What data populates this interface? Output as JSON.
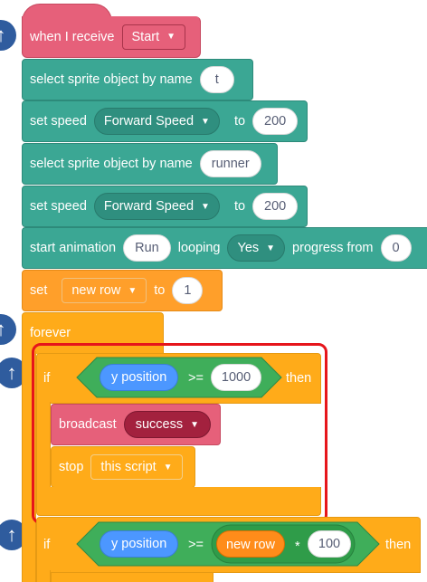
{
  "blocks": {
    "when_receive": {
      "label": "when I receive",
      "message": "Start"
    },
    "select1": {
      "label": "select sprite object by name",
      "value": "t"
    },
    "speed1": {
      "label": "set speed",
      "dropdown": "Forward Speed",
      "to": "to",
      "value": "200"
    },
    "select2": {
      "label": "select sprite object by name",
      "value": "runner"
    },
    "speed2": {
      "label": "set speed",
      "dropdown": "Forward Speed",
      "to": "to",
      "value": "200"
    },
    "anim": {
      "label": "start animation",
      "name": "Run",
      "looping": "looping",
      "loop_value": "Yes",
      "progress": "progress from",
      "progress_value": "0"
    },
    "setvar": {
      "label": "set",
      "var": "new row",
      "to": "to",
      "value": "1"
    },
    "forever": {
      "label": "forever"
    },
    "if1": {
      "if": "if",
      "reporter": "y position",
      "op": ">=",
      "value": "1000",
      "then": "then"
    },
    "broadcast": {
      "label": "broadcast",
      "message": "success"
    },
    "stop": {
      "label": "stop",
      "option": "this script"
    },
    "if2": {
      "if": "if",
      "reporter": "y position",
      "op": ">=",
      "var": "new row",
      "mult": "*",
      "value": "100",
      "then": "then"
    }
  },
  "colors": {
    "event": "#e6607a",
    "sensing_ext": "#3ba794",
    "variables": "#ff9f2a",
    "control": "#ffab19",
    "highlight": "#e6151b"
  },
  "icons": [
    "arrow-up-icon",
    "chevron-down-icon"
  ]
}
